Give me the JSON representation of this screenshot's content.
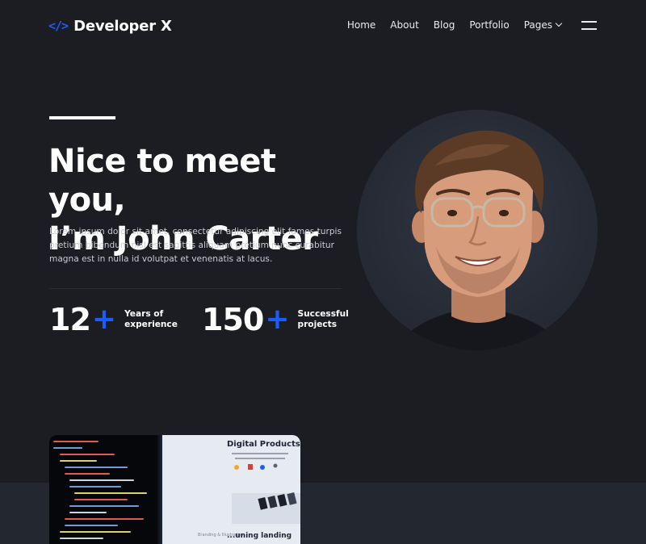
{
  "brand": {
    "mark": "</>",
    "name": "Developer X",
    "accent_color": "#1a5dff"
  },
  "nav": {
    "items": [
      "Home",
      "About",
      "Blog",
      "Portfolio"
    ],
    "pages_label": "Pages",
    "menu_icon": "hamburger-icon",
    "dropdown_icon": "chevron-down-icon"
  },
  "hero": {
    "title_line1": "Nice to meet you,",
    "title_line2": "I’m John Carter",
    "description": "Lorem ipsum dolor sit amet, consectetur adipiscing elit fames turpis pretium bibendum nisl est sagittis aliquam pretium nunc curabitur magna est in nulla id volutpat et venenatis at lacus.",
    "stats": [
      {
        "number": "12",
        "plus": "+",
        "label": "Years of experience"
      },
      {
        "number": "150",
        "plus": "+",
        "label": "Successful projects"
      }
    ]
  },
  "project_card": {
    "title": "Digital Products",
    "subtitle": "...uning landing",
    "caption": "Branding & Illustration"
  },
  "colors": {
    "background": "#1b1d23",
    "band": "#23272f",
    "accent": "#1a5dff"
  }
}
